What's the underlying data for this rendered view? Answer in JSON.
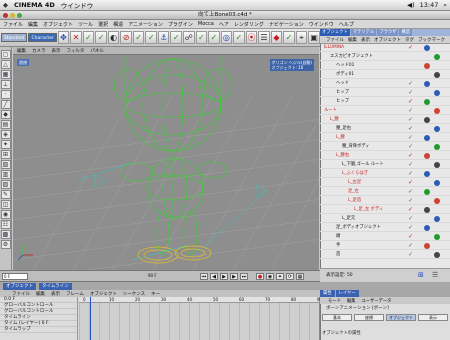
{
  "os_menubar": {
    "apple": "",
    "app": "CINEMA 4D",
    "items": [
      "ウインドウ"
    ],
    "clock": "13:47"
  },
  "window": {
    "title": "向て上Bone03.c4d *"
  },
  "menubar": {
    "items": [
      "ファイル",
      "編集",
      "オブジェクト",
      "ツール",
      "選択",
      "構造",
      "アニメーション",
      "プラグイン",
      "Mocca",
      "ヘア",
      "レンダリング",
      "ナビゲーション",
      "ウインドウ",
      "ヘルプ"
    ]
  },
  "toolbar": {
    "tabs": [
      "Standard",
      "Character"
    ],
    "active_tab": "Character"
  },
  "viewport": {
    "menu": [
      "編集",
      "カメラ",
      "表示",
      "フィルタ",
      "パネル"
    ],
    "label": "透視",
    "info_lines": [
      "ポリゴン ヘジル(自動)",
      "オブジェクト: 16"
    ]
  },
  "timeline": {
    "frame_field": "0 F",
    "end_frame": "90 F",
    "ruler_ticks": [
      "0",
      "10",
      "20",
      "30",
      "40",
      "50",
      "60",
      "70",
      "80",
      "90"
    ]
  },
  "timeline_panel": {
    "tabs": [
      "オブジェクト",
      "タイムライン"
    ],
    "menu": [
      "ファイル",
      "編集",
      "表示",
      "フレーム",
      "オブジェクト",
      "シーケンス",
      "キー"
    ],
    "rows": [
      "0.0 F",
      "グローバルコントロール",
      "グローバルコントロール",
      "タイムライン",
      "タイム (レイヤー) 0 F",
      "タイムラップ"
    ]
  },
  "right_panel": {
    "tabs": [
      "オブジェクト",
      "マテリアル",
      "ブラウザ",
      "構造"
    ],
    "menu": [
      "ファイル",
      "編集",
      "表示",
      "オブジェクト",
      "タグ",
      "ブックマーク"
    ],
    "objects": [
      {
        "name": "ILLUMINA",
        "indent": 0,
        "red": true,
        "check": true
      },
      {
        "name": "エスカピオブジェクト",
        "indent": 1,
        "red": false,
        "check": false
      },
      {
        "name": "ヘッド01",
        "indent": 2,
        "red": false,
        "check": false
      },
      {
        "name": "ボディ01",
        "indent": 2,
        "red": false,
        "check": false
      },
      {
        "name": "ヘッド",
        "indent": 2,
        "red": false,
        "check": true
      },
      {
        "name": "ヒップ",
        "indent": 2,
        "red": false,
        "check": true
      },
      {
        "name": "ヒップ",
        "indent": 2,
        "red": false,
        "check": true
      },
      {
        "name": "ルート",
        "indent": 0,
        "red": true,
        "check": true
      },
      {
        "name": "L_腰",
        "indent": 1,
        "red": true,
        "check": true
      },
      {
        "name": "腰_足右",
        "indent": 2,
        "red": false,
        "check": true
      },
      {
        "name": "L_腰",
        "indent": 2,
        "red": true,
        "check": true
      },
      {
        "name": "腰_背骨ボディ",
        "indent": 3,
        "red": false,
        "check": true
      },
      {
        "name": "L_腰右",
        "indent": 2,
        "red": true,
        "check": true
      },
      {
        "name": "L_下腿,ゴール ルート",
        "indent": 3,
        "red": false,
        "check": true
      },
      {
        "name": "L_ふくらはぎ",
        "indent": 3,
        "red": true,
        "check": true
      },
      {
        "name": "L_左足",
        "indent": 4,
        "red": true,
        "check": true
      },
      {
        "name": "足_左",
        "indent": 4,
        "red": true,
        "check": true
      },
      {
        "name": "L_足首",
        "indent": 4,
        "red": true,
        "check": true
      },
      {
        "name": "L_足_左 ボディ",
        "indent": 5,
        "red": true,
        "check": true
      },
      {
        "name": "L_足元",
        "indent": 3,
        "red": false,
        "check": true
      },
      {
        "name": "足_ボディオブジェクト",
        "indent": 2,
        "red": false,
        "check": true
      },
      {
        "name": "頭",
        "indent": 2,
        "red": false,
        "check": true
      },
      {
        "name": "手",
        "indent": 2,
        "red": false,
        "check": true
      },
      {
        "name": "首",
        "indent": 2,
        "red": false,
        "check": true
      }
    ],
    "footer_label": "表示設定: 50"
  },
  "attributes": {
    "tabs": [
      "属性",
      "レイヤー"
    ],
    "menu": [
      "モード",
      "編集",
      "ユーザーデータ"
    ],
    "title": "ボーンアニメーション [ボーン]",
    "buttons": [
      "基本",
      "座標",
      "オブジェクト",
      "表示"
    ],
    "active_button": "オブジェクト",
    "section": "オブジェクトの属性"
  },
  "colors": {
    "accent": "#2c5cb5",
    "wire_green": "#2fd62a",
    "wire_yellow": "#e8c020",
    "grid": "#9a9a9a"
  }
}
